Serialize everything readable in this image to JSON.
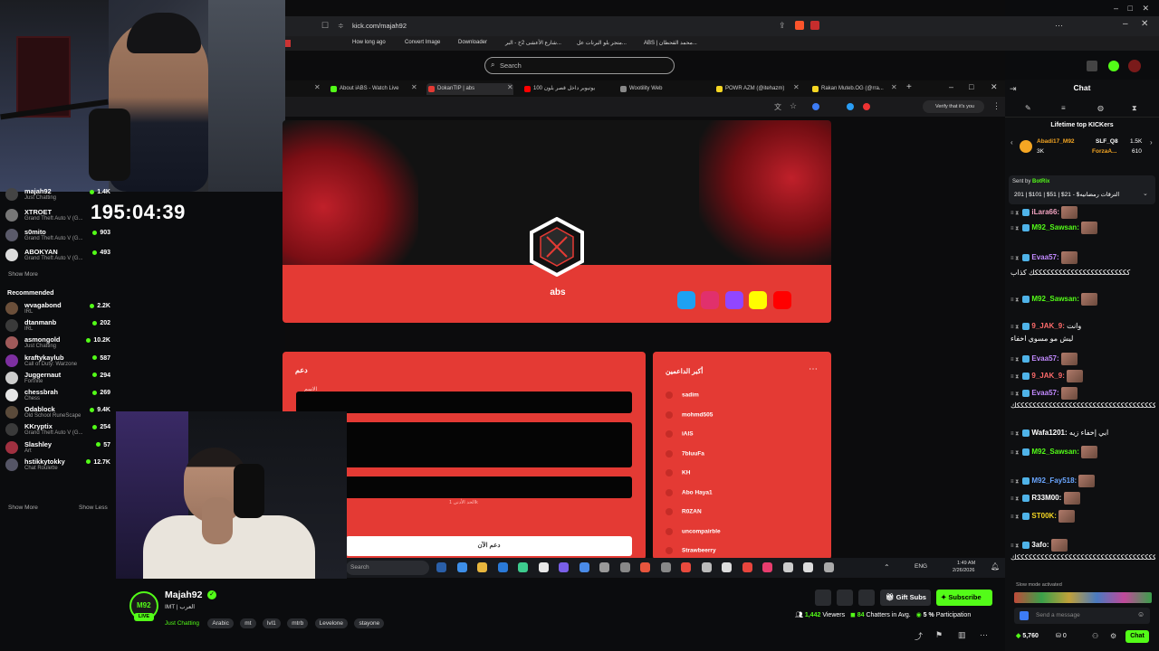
{
  "browser": {
    "url": "kick.com/majah92",
    "search_placeholder": "Search",
    "bookmarks": [
      "How long ago",
      "Convert Image",
      "Downloader",
      "شارع الأعشى 2خ - البر...",
      "متجر بلو البرنات عل...",
      "ABS | محمد القحطان..."
    ],
    "tabs": [
      "About iABS - Watch Live",
      "DokanTIP | abs",
      "100 يوتيوبر داخل قصر بلون",
      "Wootility Web",
      "POWR AZM (@itehazm)",
      "Rakan Muteb.OG (@rra..."
    ],
    "verify_text": "Verify that it's you"
  },
  "sidebar": {
    "top_items": [
      {
        "name": "majah92",
        "category": "Just Chatting",
        "count": "1.4K"
      },
      {
        "name": "XTROET",
        "category": "Grand Theft Auto V (G...",
        "count": ""
      },
      {
        "name": "s0mito",
        "category": "Grand Theft Auto V (G...",
        "count": "903"
      },
      {
        "name": "ABOKYAN",
        "category": "Grand Theft Auto V (G...",
        "count": "493"
      }
    ],
    "show_more": "Show More",
    "recommended_title": "Recommended",
    "recommended": [
      {
        "name": "wvagabond",
        "category": "IRL",
        "count": "2.2K",
        "color": "#6b4f3a"
      },
      {
        "name": "dtanmanb",
        "category": "IRL",
        "count": "202",
        "color": "#3a3a3a"
      },
      {
        "name": "asmongold",
        "category": "Just Chatting",
        "count": "10.2K",
        "color": "#a05a5a"
      },
      {
        "name": "kraftykaylub",
        "category": "Call of Duty: Warzone",
        "count": "587",
        "color": "#7d2fa0"
      },
      {
        "name": "Juggernaut",
        "category": "Fortnite",
        "count": "294",
        "color": "#cccccc"
      },
      {
        "name": "chessbrah",
        "category": "Chess",
        "count": "269",
        "color": "#e5e5e5"
      },
      {
        "name": "Odablock",
        "category": "Old School RuneScape",
        "count": "9.4K",
        "color": "#5a4a3a"
      },
      {
        "name": "KKryptix",
        "category": "Grand Theft Auto V (G...",
        "count": "254",
        "color": "#3a3a3a"
      },
      {
        "name": "Slashley",
        "category": "Art",
        "count": "57",
        "color": "#a03040"
      },
      {
        "name": "hstikkytokky",
        "category": "Chat Roulette",
        "count": "12.7K",
        "color": "#555566"
      }
    ],
    "show_more_2": "Show More",
    "show_less": "Show Less"
  },
  "timer": "195:04:39",
  "page": {
    "logo_text": "abs",
    "support_title": "دعم",
    "name_label": "الاسم",
    "min_label": "الحد الأدنى 1k",
    "support_button": "دعم الآن",
    "top_supporters_title": "أكبر الداعمين",
    "supporters": [
      "sadim",
      "mohmd505",
      "iAlS",
      "7bluuFa",
      "KH",
      "Abo Haya1",
      "R0ZAN",
      "uncompairble",
      "Strawbeerry"
    ],
    "social_colors": [
      "#1da1f2",
      "#e1306c",
      "#9146ff",
      "#fffc00",
      "#ff0000"
    ]
  },
  "taskbar": {
    "search": "Search",
    "lang": "ENG",
    "time": "1:49 AM",
    "date": "2/26/2026"
  },
  "chat": {
    "title": "Chat",
    "top_kickers_title": "Lifetime top KICKers",
    "top_kickers": [
      {
        "name": "Abadi17_M92",
        "amount": "3K"
      },
      {
        "name": "SLF_Q8",
        "amount": "1.5K"
      },
      {
        "name": "ForzaA...",
        "amount": "610"
      }
    ],
    "pinned_sender": "Sent by",
    "pinned_bot": "BotRix",
    "pinned_text": "201 | $101 | $51 | $21 - $الترقات رمضانيه",
    "messages": [
      {
        "user": "iLara66:",
        "color": "#f2a3c0",
        "text": ""
      },
      {
        "user": "M92_Sawsan:",
        "color": "#53fc18",
        "text": ""
      },
      {
        "user": "Evaa57:",
        "color": "#c28aff",
        "text": ""
      },
      {
        "user": "",
        "color": "#ffffff",
        "text": "ككككككككككككككككككككككككك كذاب"
      },
      {
        "user": "M92_Sawsan:",
        "color": "#53fc18",
        "text": ""
      },
      {
        "user": "9_JAK_9:",
        "color": "#ff6b6b",
        "text": "وانت"
      },
      {
        "user": "",
        "color": "#ffffff",
        "text": "ليش مو مسوي اخفاء"
      },
      {
        "user": "Evaa57:",
        "color": "#c28aff",
        "text": ""
      },
      {
        "user": "9_JAK_9:",
        "color": "#ff6b6b",
        "text": ""
      },
      {
        "user": "Evaa57:",
        "color": "#c28aff",
        "text": ""
      },
      {
        "user": "",
        "color": "#ffffff",
        "text": "ككككككككككككككككككككككككككككككككككككك"
      },
      {
        "user": "Wafa1201:",
        "color": "#ffffff",
        "text": "ابي إخفاء زيه"
      },
      {
        "user": "M92_Sawsan:",
        "color": "#53fc18",
        "text": ""
      },
      {
        "user": "M92_Fay518:",
        "color": "#6aa6ff",
        "text": ""
      },
      {
        "user": "R33M00:",
        "color": "#ffffff",
        "text": ""
      },
      {
        "user": "ST00K:",
        "color": "#f5d623",
        "text": ""
      },
      {
        "user": "3afo:",
        "color": "#ffffff",
        "text": ""
      },
      {
        "user": "",
        "color": "#ffffff",
        "text": "ككككككككككككككككككككككككككككككككككككككككك"
      }
    ],
    "slow_mode": "Slow mode activated",
    "input_placeholder": "Send a message",
    "points": "5,760",
    "zero": "0",
    "chat_button": "Chat"
  },
  "stream": {
    "streamer": "Majah92",
    "live_badge": "LIVE",
    "subtitle": "IMT | العرب",
    "category": "Just Chatting",
    "tags": [
      "Arabic",
      "mt",
      "lvl1",
      "mtrb",
      "Levelone",
      "stayone"
    ],
    "gift_subs": "Gift Subs",
    "subscribe": "Subscribe",
    "viewers": "1,442",
    "viewers_label": "Viewers",
    "chatters": "84",
    "chatters_label": "Chatters in Avg.",
    "participation": "5 %",
    "participation_label": "Participation"
  },
  "colors": {
    "accent": "#53fc18",
    "page_red": "#e43a34"
  }
}
